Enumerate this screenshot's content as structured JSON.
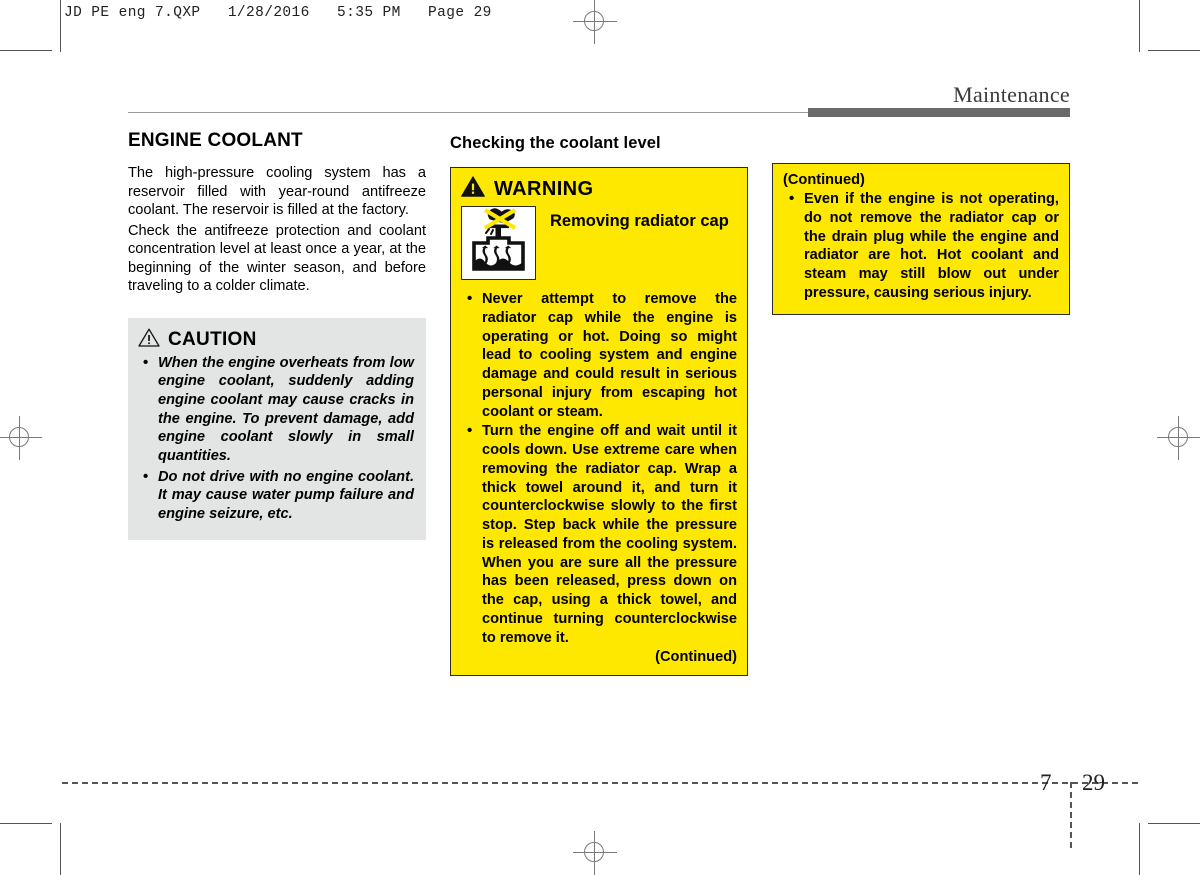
{
  "print_marks": {
    "file_stamp": "JD PE eng 7.QXP   1/28/2016   5:35 PM   Page 29"
  },
  "header": {
    "section_title": "Maintenance"
  },
  "columns": {
    "left": {
      "heading": "ENGINE COOLANT",
      "paragraphs": [
        "The high-pressure cooling system has a reservoir filled with year-round antifreeze coolant. The reservoir is filled at the factory.",
        "Check the antifreeze protection and coolant concentration level at least once a year, at the beginning of the winter season, and before traveling to a colder climate."
      ],
      "caution": {
        "icon": "warning-triangle-outline-icon",
        "label": "CAUTION",
        "items": [
          "When the engine overheats from low engine coolant, suddenly adding engine coolant may cause cracks in the engine. To prevent damage, add engine coolant slowly in small quantities.",
          "Do not drive with no engine coolant. It may cause water pump failure and engine seizure, etc."
        ]
      }
    },
    "middle": {
      "heading": "Checking the coolant level",
      "warning": {
        "icon": "warning-triangle-filled-icon",
        "label": "WARNING",
        "pictogram": "no-hand-removing-hot-radiator-cap-icon",
        "subtitle": "Removing radiator cap",
        "items": [
          "Never attempt to remove the radiator cap while the engine is operating or hot. Doing so might lead to cooling system and engine damage and could result in serious personal injury from escaping hot coolant or steam.",
          "Turn the engine off and wait until it cools down. Use extreme care when removing the radiator cap. Wrap a thick towel around it, and turn it counterclockwise slowly to the first stop. Step back while the pressure is released from the cooling system. When you are sure all the pressure has been released, press down on the cap, using a thick towel, and continue turning counterclockwise to remove it."
        ],
        "continued_tag": "(Continued)"
      }
    },
    "right": {
      "continued": {
        "lead": "(Continued)",
        "items": [
          "Even if the engine is not operating, do not remove the radiator cap or the drain plug while the engine and radiator are hot. Hot coolant and steam may still blow out under pressure, causing serious injury."
        ]
      }
    }
  },
  "footer": {
    "chapter": "7",
    "page": "29"
  },
  "colors": {
    "warning_yellow": "#ffe800",
    "caution_gray": "#e3e5e5",
    "rule_gray": "#6a6a6a"
  }
}
